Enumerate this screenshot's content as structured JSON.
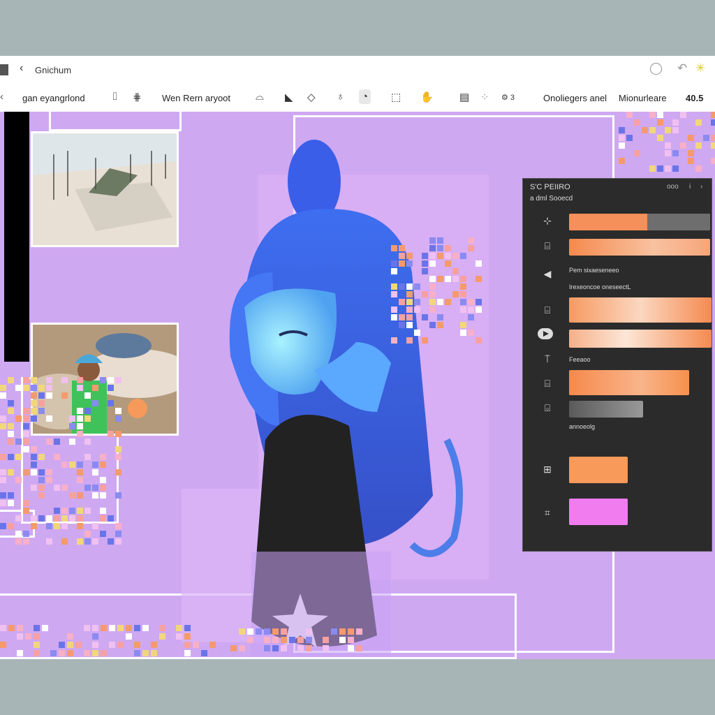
{
  "window": {
    "title": "Gnichum",
    "back_icon": "chevron-left-icon",
    "actions": [
      "refresh-icon",
      "share-icon",
      "sparkle-icon"
    ]
  },
  "toolbar": {
    "left_label": "gan eyangrlond",
    "mid_label": "Wen Rern aryoot",
    "right_label_1": "Onoliegers anel",
    "right_label_2": "Mionurleare",
    "zoom": "40.5",
    "icons": [
      "crop-icon",
      "grid-icon",
      "cup-icon",
      "fill-icon",
      "shape-icon",
      "brush-icon",
      "lasso-icon",
      "transform-icon",
      "hand-icon",
      "layers-icon",
      "dots-icon",
      "settings-icon"
    ]
  },
  "canvas": {
    "background": "#cfa8f2",
    "thumbnails": [
      "landscape-thumbnail",
      "character-scene-thumbnail"
    ]
  },
  "panel": {
    "title": "S'C PEIIRO",
    "subtitle": "a dml Sooecd",
    "controls": [
      "ooo",
      "i",
      "›"
    ],
    "label_1": "Pem sixaeseneeo",
    "label_2": "Irexeoncoe oneseectL",
    "label_3": "Feeaoo",
    "label_4": "annoeolg",
    "accent": "#f79a5a",
    "magenta": "#f07cf0"
  }
}
